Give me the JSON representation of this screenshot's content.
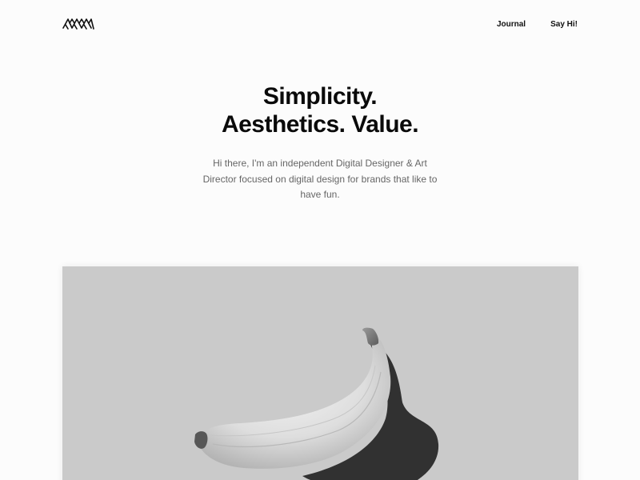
{
  "header": {
    "logo_icon": "mountains-logo-icon",
    "nav": [
      {
        "label": "Journal"
      },
      {
        "label": "Say Hi!"
      }
    ]
  },
  "hero": {
    "headline_line1": "Simplicity.",
    "headline_line2": "Aesthetics. Value.",
    "intro": "Hi there, I'm an independent Digital Designer & Art Director focused on digital design for brands that like to have fun."
  },
  "featured_image": {
    "subject": "banana-image",
    "background_color": "#cacaca"
  }
}
